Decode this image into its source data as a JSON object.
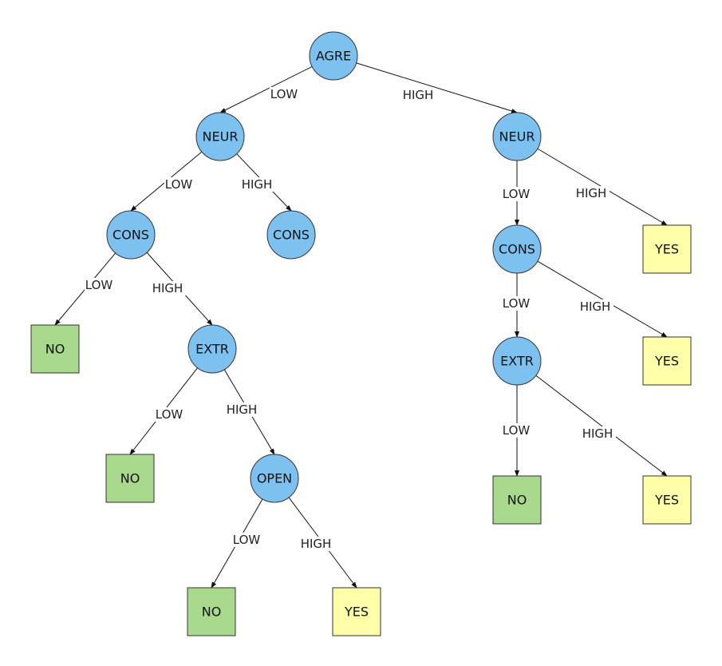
{
  "colors": {
    "attribute": "#7DC1F1",
    "no": "#A8D98C",
    "yes": "#FFFFAA",
    "stroke": "#333333"
  },
  "nodes": [
    {
      "id": "agre",
      "label": "AGRE",
      "kind": "attribute"
    },
    {
      "id": "neur1",
      "label": "NEUR",
      "kind": "attribute"
    },
    {
      "id": "neur2",
      "label": "NEUR",
      "kind": "attribute"
    },
    {
      "id": "cons1",
      "label": "CONS",
      "kind": "attribute"
    },
    {
      "id": "cons2",
      "label": "CONS",
      "kind": "attribute"
    },
    {
      "id": "no1",
      "label": "NO",
      "kind": "no"
    },
    {
      "id": "extr1",
      "label": "EXTR",
      "kind": "attribute"
    },
    {
      "id": "no2",
      "label": "NO",
      "kind": "no"
    },
    {
      "id": "open1",
      "label": "OPEN",
      "kind": "attribute"
    },
    {
      "id": "no3",
      "label": "NO",
      "kind": "no"
    },
    {
      "id": "yes1",
      "label": "YES",
      "kind": "yes"
    },
    {
      "id": "cons3",
      "label": "CONS",
      "kind": "attribute"
    },
    {
      "id": "yes2",
      "label": "YES",
      "kind": "yes"
    },
    {
      "id": "extr2",
      "label": "EXTR",
      "kind": "attribute"
    },
    {
      "id": "yes3",
      "label": "YES",
      "kind": "yes"
    },
    {
      "id": "no4",
      "label": "NO",
      "kind": "no"
    },
    {
      "id": "yes4",
      "label": "YES",
      "kind": "yes"
    }
  ],
  "edges": [
    {
      "from": "agre",
      "to": "neur1",
      "label": "LOW"
    },
    {
      "from": "agre",
      "to": "neur2",
      "label": "HIGH"
    },
    {
      "from": "neur1",
      "to": "cons1",
      "label": "LOW"
    },
    {
      "from": "neur1",
      "to": "cons2",
      "label": "HIGH"
    },
    {
      "from": "cons1",
      "to": "no1",
      "label": "LOW"
    },
    {
      "from": "cons1",
      "to": "extr1",
      "label": "HIGH"
    },
    {
      "from": "extr1",
      "to": "no2",
      "label": "LOW"
    },
    {
      "from": "extr1",
      "to": "open1",
      "label": "HIGH"
    },
    {
      "from": "open1",
      "to": "no3",
      "label": "LOW"
    },
    {
      "from": "open1",
      "to": "yes1",
      "label": "HIGH"
    },
    {
      "from": "neur2",
      "to": "cons3",
      "label": "LOW"
    },
    {
      "from": "neur2",
      "to": "yes2",
      "label": "HIGH"
    },
    {
      "from": "cons3",
      "to": "extr2",
      "label": "LOW"
    },
    {
      "from": "cons3",
      "to": "yes3",
      "label": "HIGH"
    },
    {
      "from": "extr2",
      "to": "no4",
      "label": "LOW"
    },
    {
      "from": "extr2",
      "to": "yes4",
      "label": "HIGH"
    }
  ]
}
